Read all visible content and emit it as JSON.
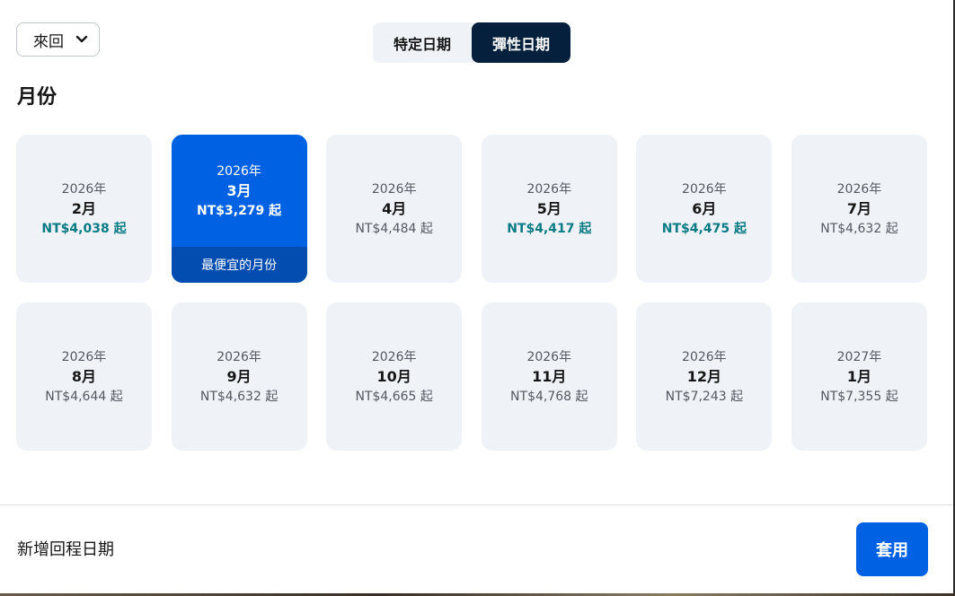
{
  "trip_type": {
    "selected": "來回"
  },
  "date_mode": {
    "specific_label": "特定日期",
    "flexible_label": "彈性日期",
    "active": "flexible"
  },
  "section_title": "月份",
  "months": [
    {
      "year": "2026年",
      "month": "2月",
      "price": "NT$4,038 起",
      "deal": true,
      "selected": false
    },
    {
      "year": "2026年",
      "month": "3月",
      "price": "NT$3,279 起",
      "deal": true,
      "selected": true,
      "badge": "最便宜的月份"
    },
    {
      "year": "2026年",
      "month": "4月",
      "price": "NT$4,484 起",
      "deal": false,
      "selected": false
    },
    {
      "year": "2026年",
      "month": "5月",
      "price": "NT$4,417 起",
      "deal": true,
      "selected": false
    },
    {
      "year": "2026年",
      "month": "6月",
      "price": "NT$4,475 起",
      "deal": true,
      "selected": false
    },
    {
      "year": "2026年",
      "month": "7月",
      "price": "NT$4,632 起",
      "deal": false,
      "selected": false
    },
    {
      "year": "2026年",
      "month": "8月",
      "price": "NT$4,644 起",
      "deal": false,
      "selected": false
    },
    {
      "year": "2026年",
      "month": "9月",
      "price": "NT$4,632 起",
      "deal": false,
      "selected": false
    },
    {
      "year": "2026年",
      "month": "10月",
      "price": "NT$4,665 起",
      "deal": false,
      "selected": false
    },
    {
      "year": "2026年",
      "month": "11月",
      "price": "NT$4,768 起",
      "deal": false,
      "selected": false
    },
    {
      "year": "2026年",
      "month": "12月",
      "price": "NT$7,243 起",
      "deal": false,
      "selected": false
    },
    {
      "year": "2027年",
      "month": "1月",
      "price": "NT$7,355 起",
      "deal": false,
      "selected": false
    }
  ],
  "footer": {
    "add_return_label": "新增回程日期",
    "apply_label": "套用"
  },
  "colors": {
    "accent": "#0062e3",
    "accent_dark": "#024daf",
    "navy": "#05203c",
    "deal_price": "#0a7b85",
    "card_bg": "#eff3f8"
  },
  "icons": {
    "trip_select_chevron": "chevron-down-icon"
  }
}
